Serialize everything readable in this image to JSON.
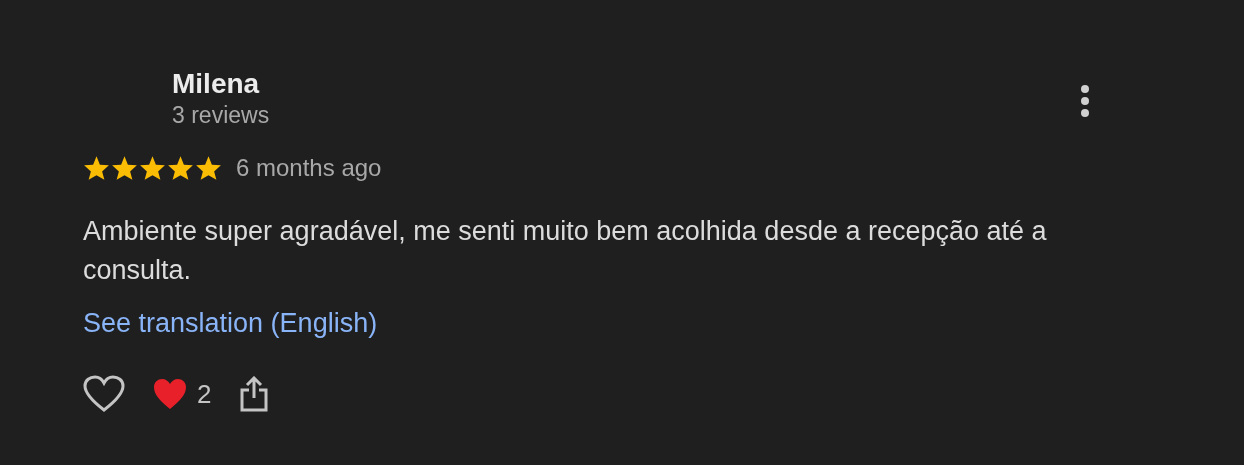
{
  "review": {
    "author": "Milena",
    "review_count": "3 reviews",
    "stars": 5,
    "time": "6 months ago",
    "text": "Ambiente super agradável, me senti muito bem acolhida desde a recepção até a consulta.",
    "translation_link": "See translation (English)",
    "liked": false,
    "reaction_count": "2"
  }
}
